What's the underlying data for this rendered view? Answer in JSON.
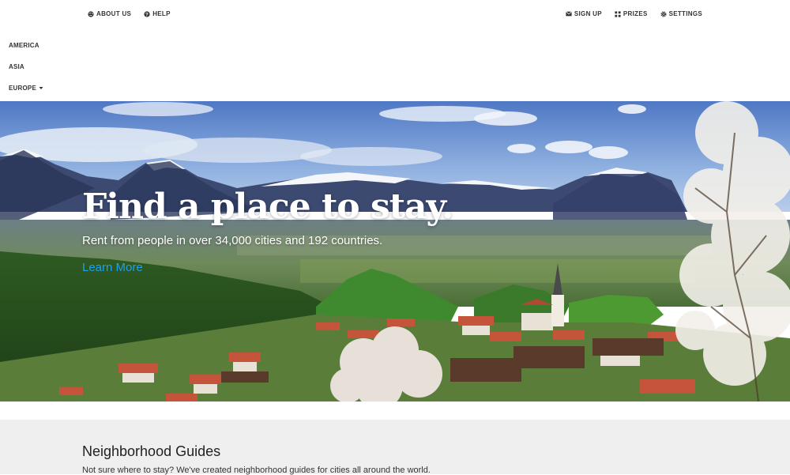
{
  "topnav": {
    "left": [
      {
        "label": "ABOUT US",
        "icon": "globe-icon"
      },
      {
        "label": "HELP",
        "icon": "question-icon"
      }
    ],
    "right": [
      {
        "label": "SIGN UP",
        "icon": "envelope-icon"
      },
      {
        "label": "PRIZES",
        "icon": "grid-icon"
      },
      {
        "label": "SETTINGS",
        "icon": "gear-icon"
      }
    ]
  },
  "regions": {
    "items": [
      {
        "label": "AMERICA"
      },
      {
        "label": "ASIA"
      },
      {
        "label": "EUROPE",
        "has_dropdown": true
      }
    ]
  },
  "hero": {
    "title": "Find a place to stay.",
    "subtitle": "Rent from people in over 34,000 cities and 192 countries.",
    "link": "Learn More"
  },
  "guides": {
    "title": "Neighborhood Guides",
    "description": "Not sure where to stay? We've created neighborhood guides for cities all around the world."
  },
  "colors": {
    "link": "#1fa0e8",
    "guides_bg": "#efefef"
  }
}
